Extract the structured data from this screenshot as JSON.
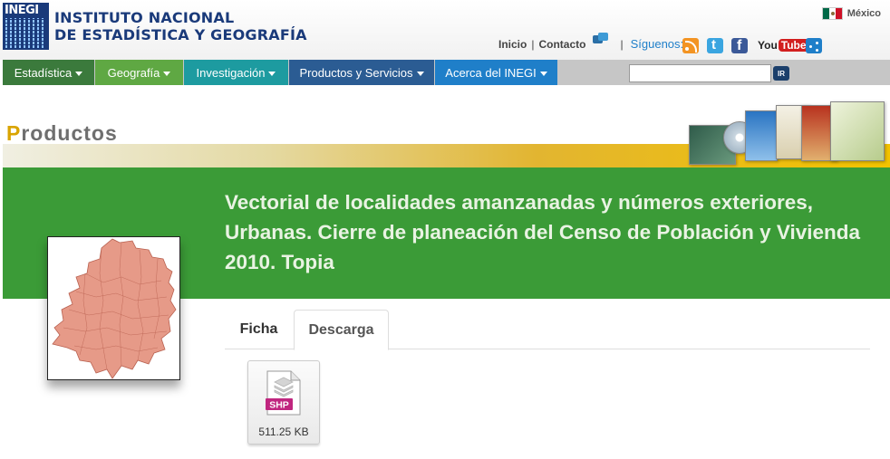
{
  "header": {
    "logo_mark": "INEGI",
    "logo_line1": "INSTITUTO NACIONAL",
    "logo_line2": "DE ESTADÍSTICA Y GEOGRAFÍA",
    "country": "México",
    "links": {
      "inicio": "Inicio",
      "contacto": "Contacto",
      "separator": "|"
    },
    "siguenos": "Síguenos:",
    "social_icons": [
      "rss-icon",
      "twitter-icon",
      "facebook-icon",
      "youtube-icon",
      "share-icon"
    ],
    "youtube_you": "You",
    "youtube_tube": "Tube"
  },
  "nav": {
    "items": [
      {
        "label": "Estadística",
        "color": "#3b7a3c"
      },
      {
        "label": "Geografía",
        "color": "#5fa843"
      },
      {
        "label": "Investigación",
        "color": "#1d9ba0"
      },
      {
        "label": "Productos y Servicios",
        "color": "#2b5c93"
      },
      {
        "label": "Acerca del INEGI",
        "color": "#1f7fc9"
      }
    ],
    "search": {
      "value": "",
      "button": "IR"
    }
  },
  "banner": {
    "title_first": "P",
    "title_rest": "roductos"
  },
  "product": {
    "title": "Vectorial de localidades amanzanadas y números exteriores, Urbanas. Cierre de planeación del Censo de Población y Vivienda 2010. Topia",
    "tabs": [
      {
        "label": "Ficha",
        "active": false
      },
      {
        "label": "Descarga",
        "active": true
      }
    ],
    "download": {
      "format": "SHP",
      "size": "511.25 KB"
    }
  },
  "colors": {
    "green_band": "#3b9b37",
    "banner_gold": "#f3c300",
    "link_blue": "#1f7fc9",
    "shp_magenta": "#c0267f"
  }
}
